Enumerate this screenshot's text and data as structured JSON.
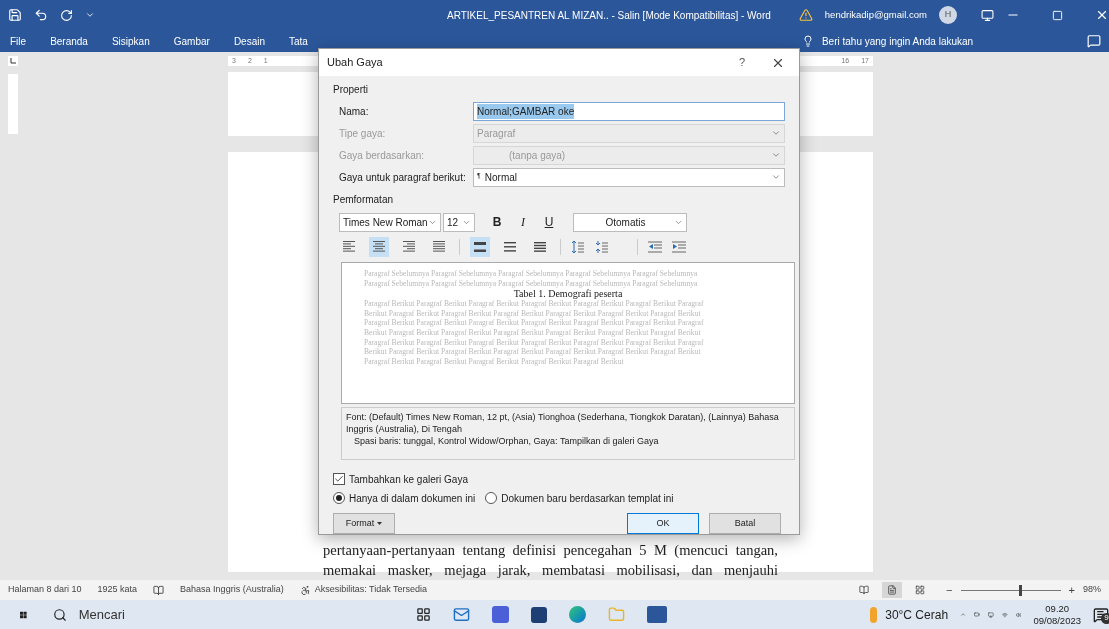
{
  "title_bar": {
    "title": "ARTIKEL_PESANTREN AL MIZAN.. - Salin [Mode Kompatibilitas] - Word",
    "account": "hendrikadip@gmail.com",
    "avatar_initial": "H"
  },
  "ribbon": {
    "tabs": [
      "File",
      "Beranda",
      "Sisipkan",
      "Gambar",
      "Desain",
      "Tata"
    ],
    "tell_me": "Beri tahu yang ingin Anda lakukan"
  },
  "ruler": {
    "left_marks": [
      "3",
      "2",
      "1"
    ],
    "right_marks": [
      "16",
      "17"
    ]
  },
  "document": {
    "lines": [
      "pertanyaan-pertanyaan tentang definisi pencegahan 5 M (mencuci tangan,",
      "memakai masker, mejaga jarak, membatasi mobilisasi, dan menjauhi"
    ]
  },
  "dialog": {
    "title": "Ubah Gaya",
    "help": "?",
    "properties": {
      "heading": "Properti",
      "rows": [
        {
          "label": "Nama:",
          "value": "Normal;GAMBAR oke",
          "kind": "text",
          "disabled": false,
          "text_selected": true
        },
        {
          "label": "Tipe gaya:",
          "value": "Paragraf",
          "kind": "dropdown",
          "disabled": true,
          "text_selected": false
        },
        {
          "label": "Gaya berdasarkan:",
          "value": "(tanpa gaya)",
          "kind": "dropdown",
          "disabled": true,
          "text_selected": false
        },
        {
          "label": "Gaya untuk paragraf berikut:",
          "prefix": "¶",
          "value": "Normal",
          "kind": "dropdown",
          "disabled": false,
          "text_selected": false
        }
      ]
    },
    "formatting": {
      "heading": "Pemformatan",
      "font": "Times New Roman",
      "size": "12",
      "bold": "B",
      "italic": "I",
      "underline": "U",
      "color_label": "Otomatis",
      "alignment_buttons": [
        {
          "selected": false
        },
        {
          "selected": true
        },
        {
          "selected": false
        },
        {
          "selected": false
        }
      ],
      "spacing_buttons": [
        {
          "selected": true
        },
        {
          "selected": false
        },
        {
          "selected": false
        }
      ]
    },
    "preview": {
      "previous": [
        "Paragraf Sebelumnya Paragraf Sebelumnya Paragraf Sebelumnya Paragraf Sebelumnya Paragraf Sebelumnya",
        "Paragraf Sebelumnya Paragraf Sebelumnya Paragraf Sebelumnya Paragraf Sebelumnya Paragraf Sebelumnya"
      ],
      "heading": "Tabel 1. Demografi peserta",
      "following": [
        "Paragraf Berikut Paragraf Berikut Paragraf Berikut Paragraf Berikut Paragraf Berikut Paragraf Berikut Paragraf",
        "Berikut Paragraf Berikut Paragraf Berikut Paragraf Berikut Paragraf Berikut Paragraf Berikut Paragraf Berikut",
        "Paragraf Berikut Paragraf Berikut Paragraf Berikut Paragraf Berikut Paragraf Berikut Paragraf Berikut Paragraf",
        "Berikut Paragraf Berikut Paragraf Berikut Paragraf Berikut Paragraf Berikut Paragraf Berikut Paragraf Berikut",
        "Paragraf Berikut Paragraf Berikut Paragraf Berikut Paragraf Berikut Paragraf Berikut Paragraf Berikut Paragraf",
        "Berikut Paragraf Berikut Paragraf Berikut Paragraf Berikut Paragraf Berikut Paragraf Berikut Paragraf Berikut",
        "Paragraf Berikut Paragraf Berikut Paragraf Berikut Paragraf Berikut Paragraf Berikut"
      ]
    },
    "description": [
      "Font: (Default) Times New Roman, 12 pt, (Asia) Tionghoa (Sederhana, Tiongkok Daratan), (Lainnya) Bahasa Inggris (Australia), Di Tengah",
      "Spasi baris:  tunggal, Kontrol Widow/Orphan, Gaya: Tampilkan di galeri Gaya"
    ],
    "add_to_gallery": {
      "label": "Tambahkan ke galeri Gaya",
      "checked": true
    },
    "scope": [
      {
        "label": "Hanya di dalam dokumen ini",
        "selected": true
      },
      {
        "label": "Dokumen baru berdasarkan templat ini",
        "selected": false
      }
    ],
    "buttons": {
      "format": "Format",
      "ok": "OK",
      "cancel": "Batal"
    }
  },
  "status_bar": {
    "page": "Halaman 8 dari 10",
    "words": "1925 kata",
    "language": "Bahasa Inggris (Australia)",
    "accessibility": "Aksesibilitas: Tidak Tersedia",
    "views": [
      {
        "selected": false
      },
      {
        "selected": true
      },
      {
        "selected": false
      }
    ],
    "zoom_out": "−",
    "zoom_in": "+",
    "zoom": {
      "level": 0.6,
      "reading": "98%"
    }
  },
  "taskbar": {
    "search_placeholder": "Mencari",
    "weather": "30°C Cerah",
    "time": "09.20",
    "date": "09/08/2023",
    "notifications": "9"
  }
}
